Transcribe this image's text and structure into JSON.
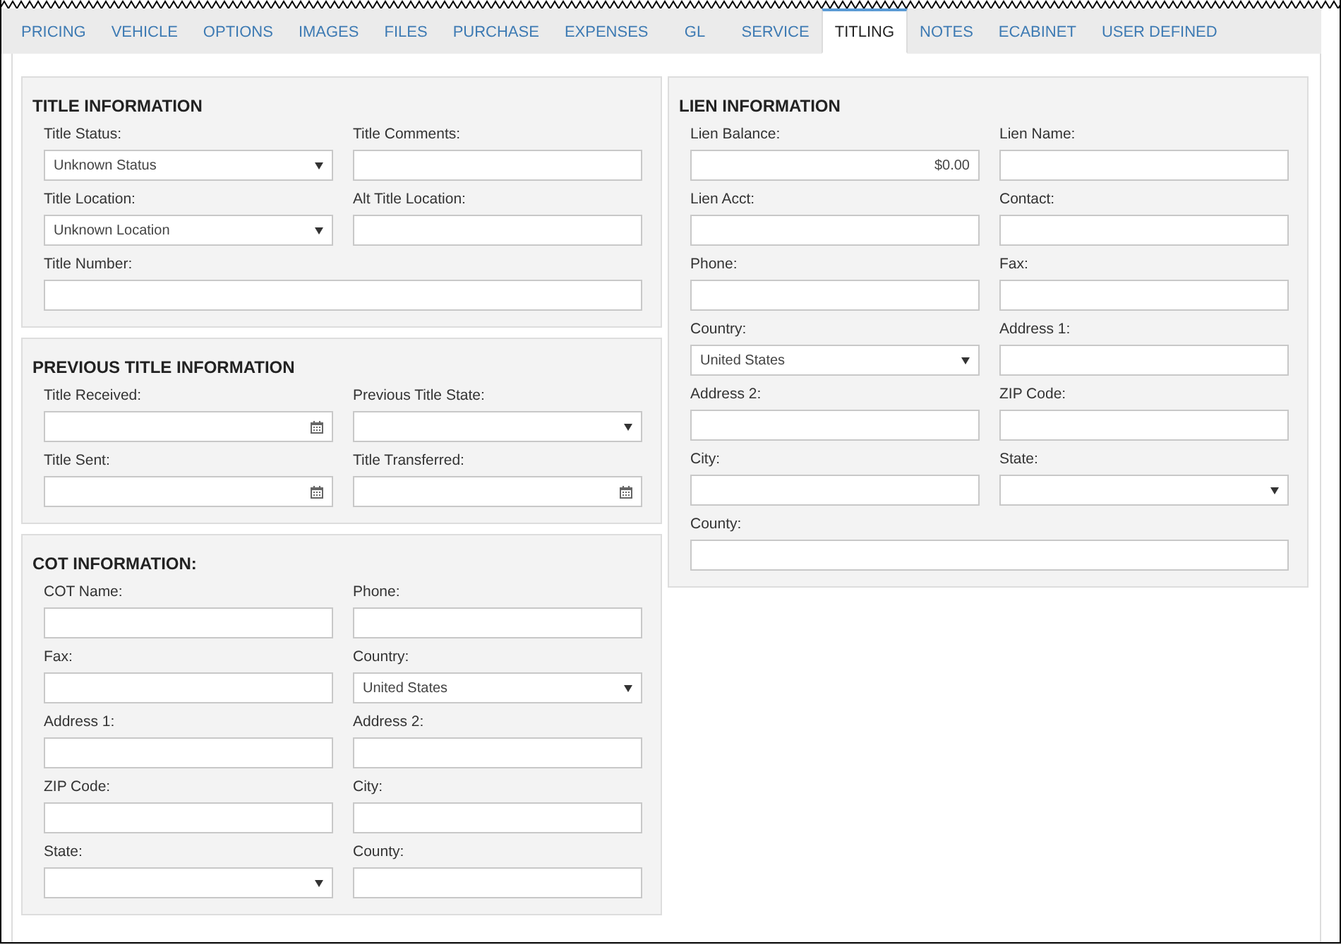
{
  "tabs": [
    {
      "label": "PRICING",
      "selected": false
    },
    {
      "label": "VEHICLE",
      "selected": false
    },
    {
      "label": "OPTIONS",
      "selected": false
    },
    {
      "label": "IMAGES",
      "selected": false
    },
    {
      "label": "FILES",
      "selected": false
    },
    {
      "label": "PURCHASE",
      "selected": false
    },
    {
      "label": "EXPENSES",
      "selected": false
    },
    {
      "label": "GL",
      "selected": false
    },
    {
      "label": "SERVICE",
      "selected": false
    },
    {
      "label": "TITLING",
      "selected": true
    },
    {
      "label": "NOTES",
      "selected": false
    },
    {
      "label": "ECABINET",
      "selected": false
    },
    {
      "label": "USER DEFINED",
      "selected": false
    }
  ],
  "left_column": [
    {
      "title": "TITLE INFORMATION",
      "fields": [
        {
          "label": "Title Status:",
          "kind": "select",
          "value": "Unknown Status"
        },
        {
          "label": "Title Comments:",
          "kind": "text"
        },
        {
          "label": "Title Location:",
          "kind": "select",
          "value": "Unknown Location"
        },
        {
          "label": "Alt Title Location:",
          "kind": "text"
        },
        {
          "label": "Title Number:",
          "kind": "text",
          "wide": true
        }
      ]
    },
    {
      "title": "PREVIOUS TITLE INFORMATION",
      "fields": [
        {
          "label": "Title Received:",
          "kind": "date"
        },
        {
          "label": "Previous Title State:",
          "kind": "select"
        },
        {
          "label": "Title Sent:",
          "kind": "date"
        },
        {
          "label": "Title Transferred:",
          "kind": "date"
        }
      ]
    },
    {
      "title": "COT INFORMATION:",
      "fields": [
        {
          "label": "COT Name:",
          "kind": "text"
        },
        {
          "label": "Phone:",
          "kind": "text"
        },
        {
          "label": "Fax:",
          "kind": "text"
        },
        {
          "label": "Country:",
          "kind": "select",
          "value": "United States"
        },
        {
          "label": "Address 1:",
          "kind": "text"
        },
        {
          "label": "Address 2:",
          "kind": "text"
        },
        {
          "label": "ZIP Code:",
          "kind": "text"
        },
        {
          "label": "City:",
          "kind": "text"
        },
        {
          "label": "State:",
          "kind": "select"
        },
        {
          "label": "County:",
          "kind": "text"
        }
      ]
    }
  ],
  "right_column": [
    {
      "title": "LIEN INFORMATION",
      "fields": [
        {
          "label": "Lien Balance:",
          "kind": "currency",
          "value": "$0.00"
        },
        {
          "label": "Lien Name:",
          "kind": "text"
        },
        {
          "label": "Lien Acct:",
          "kind": "text"
        },
        {
          "label": "Contact:",
          "kind": "text"
        },
        {
          "label": "Phone:",
          "kind": "text"
        },
        {
          "label": "Fax:",
          "kind": "text"
        },
        {
          "label": "Country:",
          "kind": "select",
          "value": "United States"
        },
        {
          "label": "Address 1:",
          "kind": "text"
        },
        {
          "label": "Address 2:",
          "kind": "text"
        },
        {
          "label": "ZIP Code:",
          "kind": "text"
        },
        {
          "label": "City:",
          "kind": "text"
        },
        {
          "label": "State:",
          "kind": "select"
        },
        {
          "label": "County:",
          "kind": "text",
          "wide": true
        }
      ]
    }
  ]
}
